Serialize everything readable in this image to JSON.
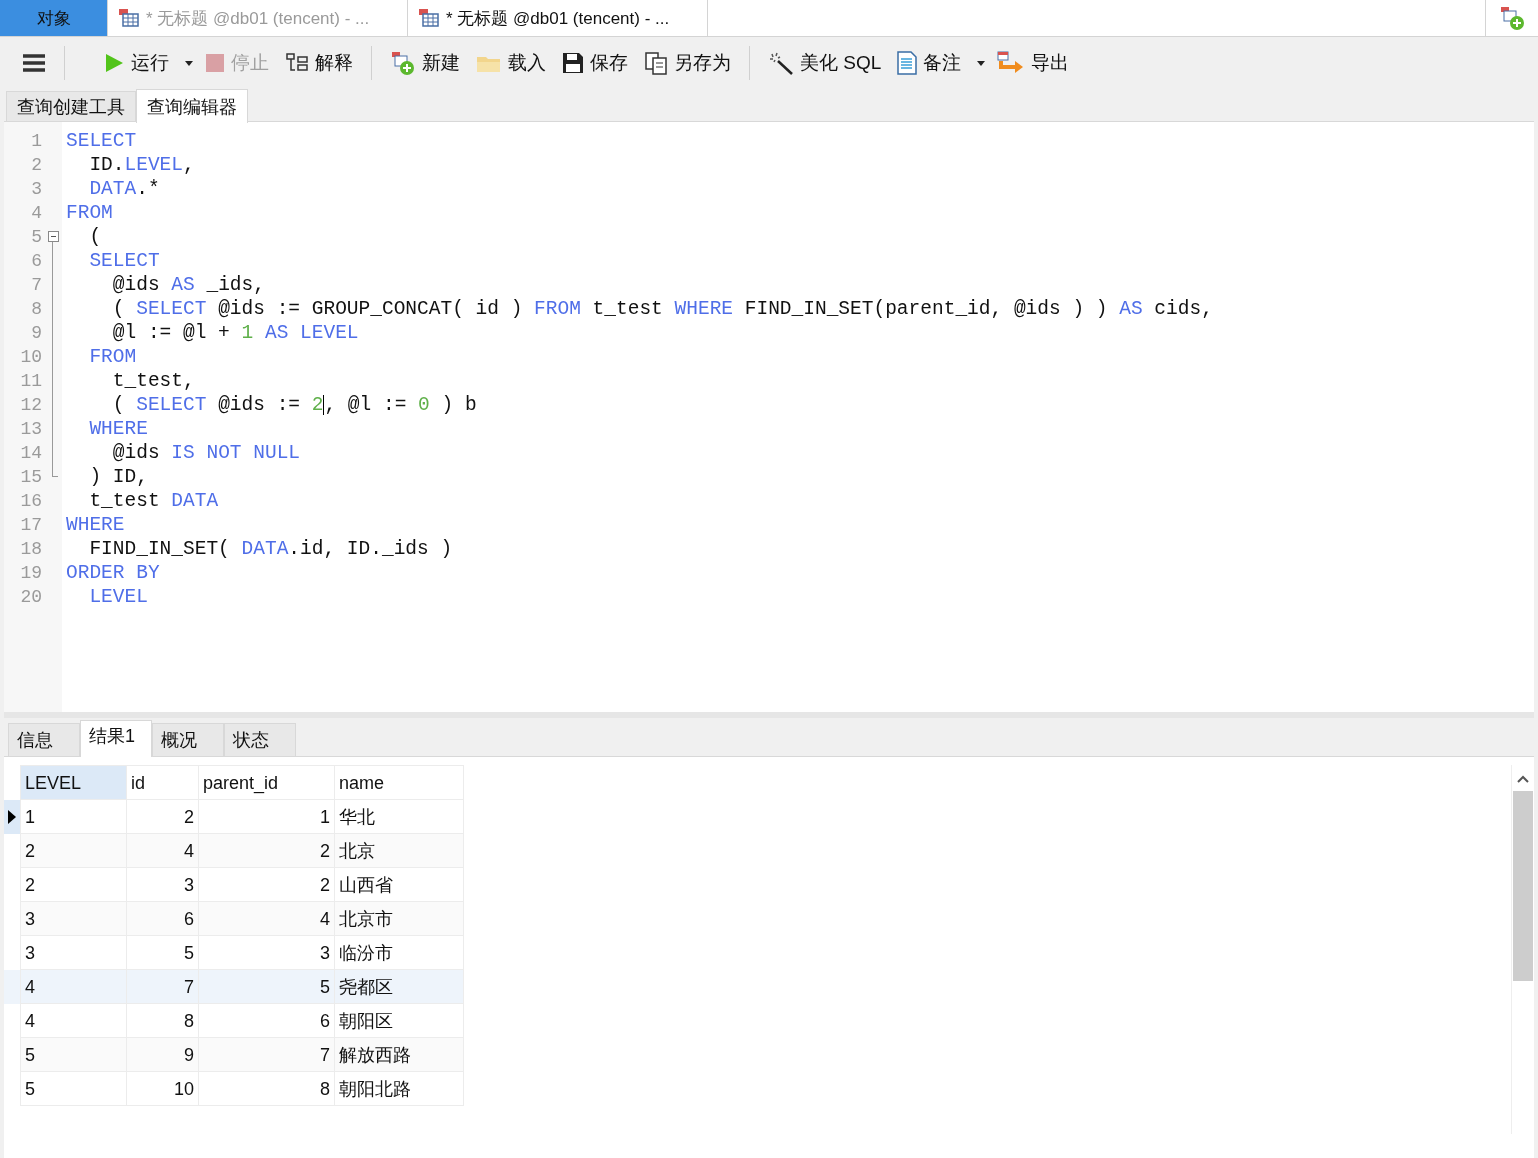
{
  "top_tabs": [
    {
      "label": "对象",
      "kind": "objects",
      "selected": false
    },
    {
      "label": "* 无标题 @db01 (tencent) - ...",
      "kind": "query",
      "selected": false
    },
    {
      "label": "* 无标题 @db01 (tencent) - ...",
      "kind": "query",
      "selected": true
    }
  ],
  "toolbar": {
    "items": [
      {
        "label": "运行",
        "dropdown": true,
        "disabled": false
      },
      {
        "label": "停止",
        "dropdown": false,
        "disabled": true
      },
      {
        "label": "解释",
        "dropdown": false,
        "disabled": false
      },
      {
        "label": "新建",
        "dropdown": false,
        "disabled": false
      },
      {
        "label": "载入",
        "dropdown": false,
        "disabled": false
      },
      {
        "label": "保存",
        "dropdown": false,
        "disabled": false
      },
      {
        "label": "另存为",
        "dropdown": false,
        "disabled": false
      },
      {
        "label": "美化 SQL",
        "dropdown": false,
        "disabled": false
      },
      {
        "label": "备注",
        "dropdown": true,
        "disabled": false
      },
      {
        "label": "导出",
        "dropdown": false,
        "disabled": false
      }
    ]
  },
  "editor_tabs": [
    {
      "label": "查询创建工具",
      "selected": false
    },
    {
      "label": "查询编辑器",
      "selected": true
    }
  ],
  "editor": {
    "lines": [
      {
        "number": "1",
        "tokens": [
          {
            "kind": "keyword",
            "text": "SELECT"
          }
        ]
      },
      {
        "number": "2",
        "tokens": [
          {
            "kind": "plain",
            "text": "  ID."
          },
          {
            "kind": "keyword",
            "text": "LEVEL"
          },
          {
            "kind": "plain",
            "text": ","
          }
        ]
      },
      {
        "number": "3",
        "tokens": [
          {
            "kind": "keyword",
            "text": "  DATA"
          },
          {
            "kind": "plain",
            "text": ".*"
          }
        ]
      },
      {
        "number": "4",
        "tokens": [
          {
            "kind": "keyword",
            "text": "FROM"
          }
        ]
      },
      {
        "number": "5",
        "expanded": true,
        "tokens": [
          {
            "kind": "plain",
            "text": "  ("
          }
        ],
        "children": [
          {
            "number": "6",
            "tokens": [
              {
                "kind": "keyword",
                "text": "  SELECT"
              }
            ]
          },
          {
            "number": "7",
            "tokens": [
              {
                "kind": "plain",
                "text": "    @ids "
              },
              {
                "kind": "keyword",
                "text": "AS"
              },
              {
                "kind": "plain",
                "text": " _ids,"
              }
            ]
          },
          {
            "number": "8",
            "tokens": [
              {
                "kind": "plain",
                "text": "    ( "
              },
              {
                "kind": "keyword",
                "text": "SELECT"
              },
              {
                "kind": "plain",
                "text": " @ids := GROUP_CONCAT( id ) "
              },
              {
                "kind": "keyword",
                "text": "FROM"
              },
              {
                "kind": "plain",
                "text": " t_test "
              },
              {
                "kind": "keyword",
                "text": "WHERE"
              },
              {
                "kind": "plain",
                "text": " FIND_IN_SET(parent_id, @ids ) ) "
              },
              {
                "kind": "keyword",
                "text": "AS"
              },
              {
                "kind": "plain",
                "text": " cids,"
              }
            ]
          },
          {
            "number": "9",
            "tokens": [
              {
                "kind": "plain",
                "text": "    @l := @l + "
              },
              {
                "kind": "number",
                "text": "1"
              },
              {
                "kind": "keyword",
                "text": " AS LEVEL"
              }
            ]
          },
          {
            "number": "10",
            "tokens": [
              {
                "kind": "keyword",
                "text": "  FROM"
              }
            ]
          },
          {
            "number": "11",
            "tokens": [
              {
                "kind": "plain",
                "text": "    t_test,"
              }
            ]
          },
          {
            "number": "12",
            "tokens": [
              {
                "kind": "plain",
                "text": "    ( "
              },
              {
                "kind": "keyword",
                "text": "SELECT"
              },
              {
                "kind": "plain",
                "text": " @ids := "
              },
              {
                "kind": "number",
                "text": "2",
                "cursor_after": true
              },
              {
                "kind": "plain",
                "text": ", @l := "
              },
              {
                "kind": "number",
                "text": "0"
              },
              {
                "kind": "plain",
                "text": " ) b"
              }
            ]
          },
          {
            "number": "13",
            "tokens": [
              {
                "kind": "keyword",
                "text": "  WHERE"
              }
            ]
          },
          {
            "number": "14",
            "tokens": [
              {
                "kind": "plain",
                "text": "    @ids "
              },
              {
                "kind": "keyword",
                "text": "IS NOT NULL"
              }
            ]
          },
          {
            "number": "15",
            "tokens": [
              {
                "kind": "plain",
                "text": "  ) ID,"
              }
            ]
          }
        ]
      },
      {
        "number": "16",
        "tokens": [
          {
            "kind": "plain",
            "text": "  t_test "
          },
          {
            "kind": "keyword",
            "text": "DATA"
          }
        ]
      },
      {
        "number": "17",
        "tokens": [
          {
            "kind": "keyword",
            "text": "WHERE"
          }
        ]
      },
      {
        "number": "18",
        "tokens": [
          {
            "kind": "plain",
            "text": "  FIND_IN_SET( "
          },
          {
            "kind": "keyword",
            "text": "DATA"
          },
          {
            "kind": "plain",
            "text": ".id, ID._ids )"
          }
        ]
      },
      {
        "number": "19",
        "tokens": [
          {
            "kind": "keyword",
            "text": "ORDER BY"
          }
        ]
      },
      {
        "number": "20",
        "tokens": [
          {
            "kind": "keyword",
            "text": "  LEVEL"
          }
        ]
      }
    ]
  },
  "result_tabs": [
    {
      "label": "信息",
      "selected": false
    },
    {
      "label": "结果1",
      "selected": true
    },
    {
      "label": "概况",
      "selected": false
    },
    {
      "label": "状态",
      "selected": false
    }
  ],
  "table": {
    "columns": [
      {
        "label": "LEVEL",
        "selected": true
      },
      {
        "label": "id",
        "selected": false
      },
      {
        "label": "parent_id",
        "selected": false
      },
      {
        "label": "name",
        "selected": false
      }
    ],
    "rows": [
      {
        "current": true,
        "highlighted": false,
        "cells": [
          "1",
          "2",
          "1",
          "华北"
        ]
      },
      {
        "current": false,
        "highlighted": false,
        "cells": [
          "2",
          "4",
          "2",
          "北京"
        ]
      },
      {
        "current": false,
        "highlighted": false,
        "cells": [
          "2",
          "3",
          "2",
          "山西省"
        ]
      },
      {
        "current": false,
        "highlighted": false,
        "cells": [
          "3",
          "6",
          "4",
          "北京市"
        ]
      },
      {
        "current": false,
        "highlighted": false,
        "cells": [
          "3",
          "5",
          "3",
          "临汾市"
        ]
      },
      {
        "current": false,
        "highlighted": true,
        "cells": [
          "4",
          "7",
          "5",
          "尧都区"
        ]
      },
      {
        "current": false,
        "highlighted": false,
        "cells": [
          "4",
          "8",
          "6",
          "朝阳区"
        ]
      },
      {
        "current": false,
        "highlighted": false,
        "cells": [
          "5",
          "9",
          "7",
          "解放西路"
        ]
      },
      {
        "current": false,
        "highlighted": false,
        "cells": [
          "5",
          "10",
          "8",
          "朝阳北路"
        ]
      }
    ]
  }
}
